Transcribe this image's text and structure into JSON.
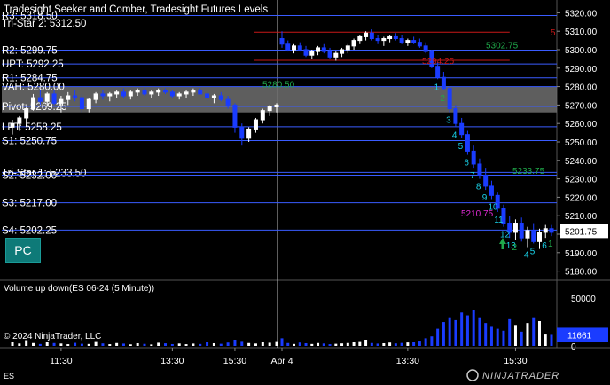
{
  "title": "Tradesight Seeker and Comber, Tradesight Futures Levels",
  "tri_star_label": "Tri-Star 2: 5312.50",
  "pc_button_label": "PC",
  "volume_title": "Volume up down(ES 06-24 (5 Minute))",
  "copyright": "© 2024 NinjaTrader, LLC",
  "instrument": "ES",
  "ninjatrader_logo": "NINJATRADER",
  "current_price_label": "5201.75",
  "current_volume_label": "11661",
  "colors": {
    "bull_candle": "#ffffff",
    "bear_candle": "#1a3cff",
    "level_blue": "#3a5cff",
    "level_red": "#c81818",
    "value_area_fill": "#6e6e6e",
    "seq_green": "#1fa94a",
    "seq_cyan": "#19d0e6",
    "seq_magenta": "#e02ad6",
    "pc_button": "#0e7a78"
  },
  "chart_data": {
    "type": "candlestick",
    "ylim": [
      5175,
      5325
    ],
    "y_ticks": [
      "5320.00",
      "5310.00",
      "5300.00",
      "5290.00",
      "5280.00",
      "5270.00",
      "5260.00",
      "5250.00",
      "5240.00",
      "5230.00",
      "5220.00",
      "5210.00",
      "5200.00",
      "5190.00",
      "5180.00"
    ],
    "x_ticks": [
      "11:30",
      "13:30",
      "15:30",
      "Apr 4",
      "13:30",
      "15:30"
    ],
    "levels": [
      {
        "label": "R3: 5318.50",
        "price": 5318.5,
        "color": "blue"
      },
      {
        "label": "R2: 5299.75",
        "price": 5299.75,
        "color": "blue"
      },
      {
        "label": "UPT: 5292.25",
        "price": 5292.25,
        "color": "blue"
      },
      {
        "label": "R1: 5284.75",
        "price": 5284.75,
        "color": "blue"
      },
      {
        "label": "VAH: 5280.00",
        "price": 5280.0,
        "color": "blue"
      },
      {
        "label": "Pivot: 5269.25",
        "price": 5269.25,
        "color": "blue"
      },
      {
        "label": "LPT: 5258.25",
        "price": 5258.25,
        "color": "blue"
      },
      {
        "label": "S1: 5250.75",
        "price": 5250.75,
        "color": "blue"
      },
      {
        "label": "Tri-Star 1: 5233.50",
        "price": 5233.5,
        "color": "blue"
      },
      {
        "label": "S2: 5232.00",
        "price": 5232.0,
        "color": "blue"
      },
      {
        "label": "S3: 5217.00",
        "price": 5217.0,
        "color": "blue"
      },
      {
        "label": "S4: 5202.25",
        "price": 5202.25,
        "color": "blue"
      }
    ],
    "value_area": {
      "high": 5280.0,
      "low": 5266.0
    },
    "red_levels": [
      {
        "price": 5309.5,
        "x_start": 0.455,
        "x_end": 0.915
      },
      {
        "price": 5294.25,
        "x_start": 0.455,
        "x_end": 0.915
      }
    ],
    "annotations": [
      {
        "text": "5302.75",
        "price": 5302.75,
        "color": "green"
      },
      {
        "text": "5280.50",
        "price": 5281.5,
        "color": "green"
      },
      {
        "text": "5294.25",
        "price": 5294.25,
        "color": "red"
      },
      {
        "text": "5233.75",
        "price": 5234.5,
        "color": "green"
      },
      {
        "text": "5210.75",
        "price": 5211.5,
        "color": "magenta"
      },
      {
        "text": "5",
        "price": 5309.5,
        "color": "red"
      }
    ],
    "candles": [
      [
        5258,
        5262,
        5254,
        5260
      ],
      [
        5260,
        5264,
        5256,
        5263
      ],
      [
        5263,
        5269,
        5260,
        5268
      ],
      [
        5268,
        5276,
        5267,
        5274
      ],
      [
        5274,
        5278,
        5270,
        5272
      ],
      [
        5272,
        5277,
        5269,
        5276
      ],
      [
        5276,
        5278,
        5270,
        5271
      ],
      [
        5271,
        5275,
        5266,
        5273
      ],
      [
        5273,
        5277,
        5270,
        5275
      ],
      [
        5275,
        5278,
        5272,
        5274
      ],
      [
        5274,
        5276,
        5266,
        5268
      ],
      [
        5268,
        5274,
        5266,
        5273
      ],
      [
        5273,
        5277,
        5271,
        5276
      ],
      [
        5276,
        5278,
        5273,
        5275
      ],
      [
        5275,
        5277,
        5272,
        5276
      ],
      [
        5276,
        5278,
        5274,
        5277
      ],
      [
        5277,
        5279,
        5274,
        5275
      ],
      [
        5275,
        5278,
        5273,
        5277
      ],
      [
        5277,
        5279,
        5275,
        5278
      ],
      [
        5278,
        5279,
        5275,
        5276
      ],
      [
        5276,
        5278,
        5274,
        5277
      ],
      [
        5277,
        5279,
        5275,
        5278
      ],
      [
        5278,
        5279,
        5276,
        5277
      ],
      [
        5277,
        5278,
        5274,
        5275
      ],
      [
        5275,
        5277,
        5273,
        5276
      ],
      [
        5276,
        5278,
        5274,
        5277
      ],
      [
        5277,
        5279,
        5275,
        5278
      ],
      [
        5278,
        5279,
        5276,
        5276
      ],
      [
        5276,
        5277,
        5272,
        5274
      ],
      [
        5274,
        5276,
        5271,
        5275
      ],
      [
        5275,
        5277,
        5272,
        5273
      ],
      [
        5273,
        5275,
        5268,
        5270
      ],
      [
        5270,
        5271,
        5255,
        5258
      ],
      [
        5258,
        5260,
        5248,
        5252
      ],
      [
        5252,
        5258,
        5250,
        5257
      ],
      [
        5257,
        5263,
        5255,
        5262
      ],
      [
        5262,
        5268,
        5260,
        5267
      ],
      [
        5267,
        5270,
        5264,
        5269
      ],
      [
        5269,
        5271,
        5266,
        5270
      ],
      [
        5306,
        5310,
        5301,
        5303
      ],
      [
        5303,
        5305,
        5299,
        5300
      ],
      [
        5300,
        5303,
        5298,
        5302
      ],
      [
        5302,
        5304,
        5299,
        5300
      ],
      [
        5300,
        5302,
        5296,
        5297
      ],
      [
        5297,
        5300,
        5295,
        5299
      ],
      [
        5299,
        5302,
        5297,
        5301
      ],
      [
        5301,
        5303,
        5298,
        5299
      ],
      [
        5299,
        5301,
        5295,
        5296
      ],
      [
        5296,
        5299,
        5294,
        5298
      ],
      [
        5298,
        5301,
        5296,
        5300
      ],
      [
        5300,
        5303,
        5298,
        5302
      ],
      [
        5302,
        5306,
        5300,
        5305
      ],
      [
        5305,
        5308,
        5303,
        5307
      ],
      [
        5307,
        5310,
        5305,
        5309
      ],
      [
        5309,
        5311,
        5305,
        5306
      ],
      [
        5306,
        5308,
        5303,
        5305
      ],
      [
        5305,
        5307,
        5302,
        5306
      ],
      [
        5306,
        5308,
        5304,
        5307
      ],
      [
        5307,
        5309,
        5305,
        5306
      ],
      [
        5306,
        5308,
        5303,
        5304
      ],
      [
        5304,
        5306,
        5302,
        5305
      ],
      [
        5305,
        5307,
        5303,
        5304
      ],
      [
        5304,
        5306,
        5301,
        5302
      ],
      [
        5302,
        5304,
        5298,
        5299
      ],
      [
        5299,
        5300,
        5290,
        5291
      ],
      [
        5291,
        5293,
        5284,
        5285
      ],
      [
        5285,
        5288,
        5278,
        5279
      ],
      [
        5279,
        5280,
        5266,
        5268
      ],
      [
        5268,
        5270,
        5258,
        5260
      ],
      [
        5260,
        5263,
        5252,
        5254
      ],
      [
        5254,
        5256,
        5243,
        5245
      ],
      [
        5245,
        5248,
        5236,
        5238
      ],
      [
        5238,
        5241,
        5230,
        5232
      ],
      [
        5232,
        5236,
        5224,
        5226
      ],
      [
        5226,
        5229,
        5219,
        5221
      ],
      [
        5221,
        5223,
        5212,
        5214
      ],
      [
        5214,
        5216,
        5204,
        5206
      ],
      [
        5206,
        5210,
        5198,
        5201
      ],
      [
        5201,
        5208,
        5197,
        5206
      ],
      [
        5206,
        5209,
        5196,
        5198
      ],
      [
        5198,
        5204,
        5193,
        5202
      ],
      [
        5202,
        5206,
        5195,
        5196
      ],
      [
        5196,
        5203,
        5192,
        5201
      ],
      [
        5201,
        5205,
        5198,
        5203
      ],
      [
        5203,
        5205,
        5199,
        5201
      ]
    ],
    "volume": {
      "ylim": [
        0,
        65000
      ],
      "y_ticks": [
        "50000",
        "0"
      ],
      "values": [
        4000,
        2500,
        6000,
        3000,
        2000,
        4500,
        3000,
        2500,
        1800,
        3200,
        2200,
        2000,
        5000,
        2600,
        1800,
        3000,
        2400,
        1600,
        2800,
        2100,
        1500,
        3300,
        2700,
        1900,
        2500,
        1800,
        2400,
        2000,
        4200,
        2800,
        2200,
        3500,
        6500,
        5200,
        3000,
        2500,
        4000,
        3300,
        5000,
        8000,
        3000,
        2000,
        3500,
        2800,
        2000,
        3000,
        2500,
        1800,
        2200,
        2600,
        3000,
        4200,
        5000,
        6500,
        3000,
        2400,
        2800,
        3500,
        2600,
        3100,
        3600,
        4200,
        5500,
        8000,
        10000,
        18000,
        25000,
        30000,
        27000,
        35000,
        32000,
        38000,
        30000,
        24000,
        20000,
        18000,
        16000,
        28000,
        22000,
        15000,
        24000,
        30000,
        26000,
        12000,
        11661
      ]
    }
  }
}
